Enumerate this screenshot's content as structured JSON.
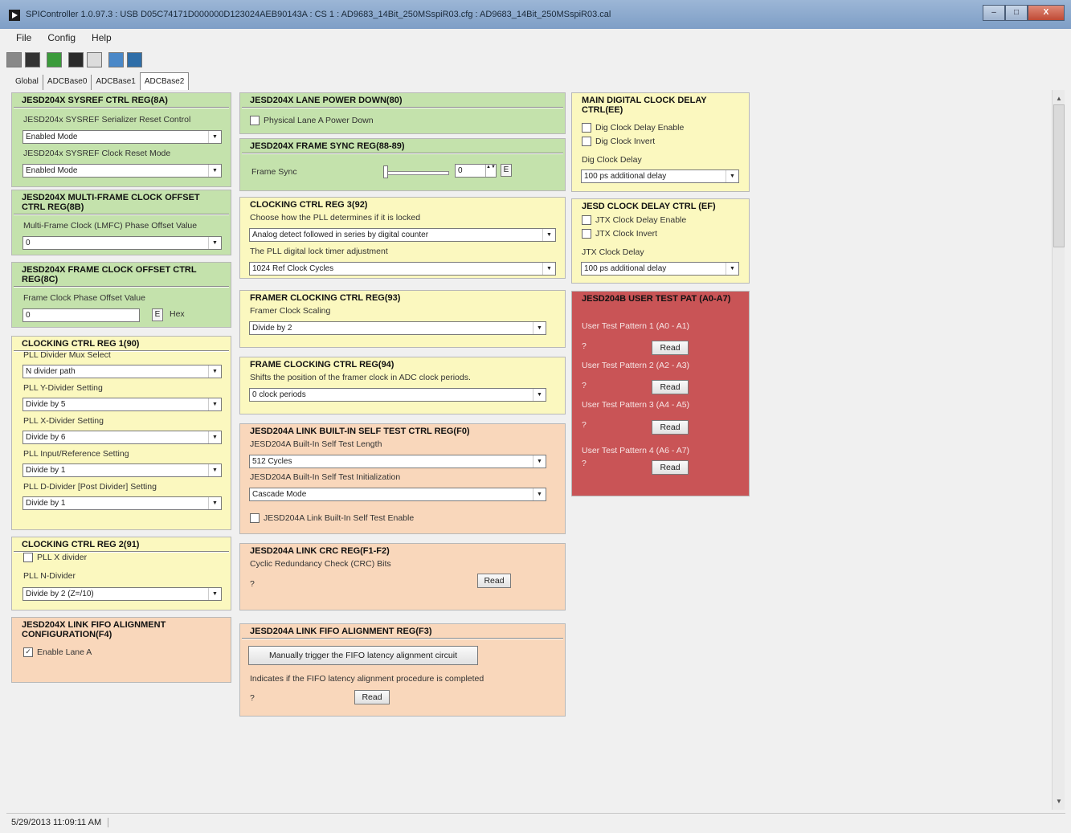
{
  "window": {
    "title": "SPIController 1.0.97.3 : USB D05C74171D000000D123024AEB90143A : CS 1 : AD9683_14Bit_250MSspiR03.cfg : AD9683_14Bit_250MSspiR03.cal",
    "minimize_glyph": "–",
    "maximize_glyph": "□",
    "close_glyph": "X"
  },
  "menu": [
    "File",
    "Config",
    "Help"
  ],
  "toolbar": {
    "icons": [
      "stop-icon",
      "save-icon",
      "new-icon",
      "open-icon",
      "table-icon",
      "chart-icon",
      "download-icon"
    ]
  },
  "tabs": [
    "Global",
    "ADCBase0",
    "ADCBase1",
    "ADCBase2"
  ],
  "active_tab": "ADCBase2",
  "colors": {
    "green": "#c4e2ac",
    "yellow": "#fbf8bf",
    "orange": "#f9d7bb",
    "red": "#c95456"
  },
  "status": {
    "time": "5/29/2013 11:09:11 AM"
  },
  "col1": {
    "sysref": {
      "title": "JESD204X SYSREF CTRL REG(8A)",
      "label1": "JESD204x SYSREF Serializer Reset Control",
      "value1": "Enabled Mode",
      "label2": "JESD204x SYSREF Clock Reset Mode",
      "value2": "Enabled Mode"
    },
    "lmfc": {
      "title": "JESD204X MULTI-FRAME CLOCK OFFSET CTRL REG(8B)",
      "label": "Multi-Frame Clock (LMFC) Phase Offset Value",
      "value": "0"
    },
    "frameclk": {
      "title": "JESD204X FRAME CLOCK OFFSET CTRL REG(8C)",
      "label": "Frame Clock Phase Offset Value",
      "value": "0",
      "e": "E",
      "hex": "Hex"
    },
    "clk1": {
      "title": "CLOCKING CTRL REG 1(90)",
      "l1": "PLL Divider Mux Select",
      "v1": "N divider path",
      "l2": "PLL Y-Divider Setting",
      "v2": "Divide by 5",
      "l3": "PLL X-Divider Setting",
      "v3": "Divide by 6",
      "l4": "PLL Input/Reference Setting",
      "v4": "Divide by 1",
      "l5": "PLL D-Divider [Post Divider] Setting",
      "v5": "Divide by 1"
    },
    "clk2": {
      "title": "CLOCKING CTRL REG 2(91)",
      "cb": "PLL X divider",
      "label": "PLL N-Divider",
      "value": "Divide by 2 (Z=/10)"
    },
    "fifo": {
      "title": "JESD204X LINK FIFO ALIGNMENT CONFIGURATION(F4)",
      "cb": "Enable Lane A",
      "checked": "✓"
    }
  },
  "col2": {
    "lanepd": {
      "title": "JESD204X LANE POWER DOWN(80)",
      "cb": "Physical Lane A Power Down"
    },
    "framesync": {
      "title": "JESD204X FRAME SYNC REG(88-89)",
      "label": "Frame Sync",
      "value": "0",
      "e": "E",
      "spin_glyph": "▲▼"
    },
    "clk3": {
      "title": "CLOCKING CTRL REG 3(92)",
      "l1": "Choose how the PLL determines if it is locked",
      "v1": "Analog detect followed in series by digital counter",
      "l2": "The PLL digital lock timer adjustment",
      "v2": "1024 Ref Clock Cycles"
    },
    "framer": {
      "title": "FRAMER CLOCKING CTRL REG(93)",
      "label": "Framer Clock Scaling",
      "value": "Divide by 2"
    },
    "frameclk": {
      "title": "FRAME CLOCKING CTRL REG(94)",
      "label": "Shifts the position of the framer clock in ADC clock periods.",
      "value": "0 clock periods"
    },
    "bist": {
      "title": "JESD204A LINK BUILT-IN SELF TEST CTRL REG(F0)",
      "l1": "JESD204A Built-In Self Test Length",
      "v1": "512 Cycles",
      "l2": "JESD204A Built-In Self Test Initialization",
      "v2": "Cascade Mode",
      "cb": "JESD204A Link Built-In Self Test Enable"
    },
    "crc": {
      "title": "JESD204A LINK CRC REG(F1-F2)",
      "label": "Cyclic Redundancy Check (CRC) Bits",
      "value": "?",
      "btn": "Read"
    },
    "fifoalign": {
      "title": "JESD204A LINK FIFO ALIGNMENT REG(F3)",
      "btn1": "Manually trigger the FIFO latency alignment circuit",
      "label": "Indicates if the FIFO latency alignment procedure is completed",
      "value": "?",
      "btn2": "Read"
    }
  },
  "col3": {
    "maindig": {
      "title": "MAIN DIGITAL CLOCK DELAY CTRL(EE)",
      "cb1": "Dig Clock Delay Enable",
      "cb2": "Dig Clock Invert",
      "label": "Dig Clock Delay",
      "value": "100 ps additional delay"
    },
    "jesdclk": {
      "title": "JESD CLOCK DELAY CTRL (EF)",
      "cb1": "JTX Clock Delay Enable",
      "cb2": "JTX Clock Invert",
      "label": "JTX Clock Delay",
      "value": "100 ps additional delay"
    },
    "testpat": {
      "title": "JESD204B USER TEST PAT (A0-A7)",
      "items": [
        {
          "label": "User Test Pattern 1 (A0 - A1)",
          "value": "?",
          "btn": "Read"
        },
        {
          "label": "User Test Pattern 2 (A2 - A3)",
          "value": "?",
          "btn": "Read"
        },
        {
          "label": "User Test Pattern 3 (A4 - A5)",
          "value": "?",
          "btn": "Read"
        },
        {
          "label": "User Test Pattern 4 (A6 - A7)",
          "value": "?",
          "btn": "Read"
        }
      ]
    }
  }
}
